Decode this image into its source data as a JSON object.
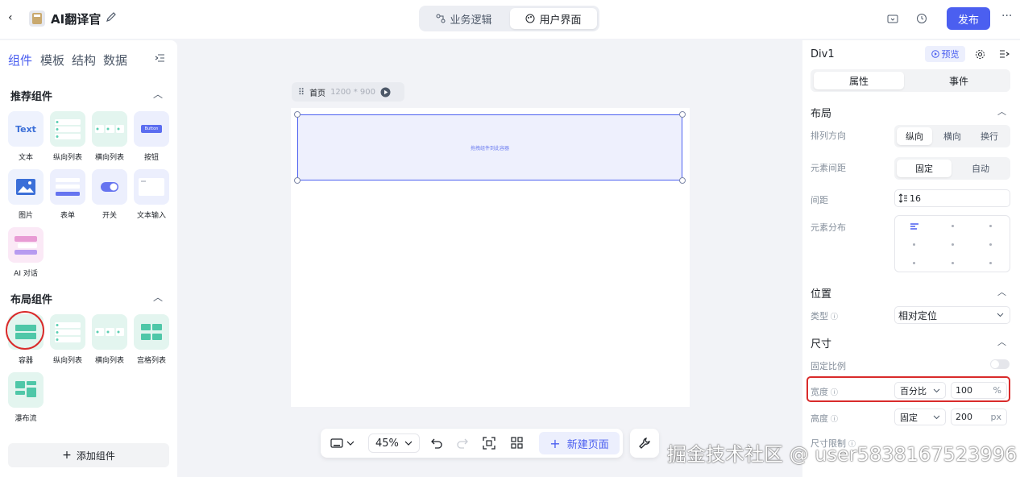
{
  "app": {
    "title": "AI翻译官",
    "back_icon": "chevron-left-icon",
    "edit_icon": "pencil-icon"
  },
  "mode_tabs": [
    {
      "label": "业务逻辑",
      "icon": "flow-icon"
    },
    {
      "label": "用户界面",
      "icon": "palette-icon"
    }
  ],
  "topbar": {
    "publish_label": "发布",
    "accent": "#4b5ff0"
  },
  "left_panel": {
    "tabs": [
      "组件",
      "模板",
      "结构",
      "数据"
    ],
    "recommended": {
      "title": "推荐组件",
      "items": [
        "文本",
        "纵向列表",
        "横向列表",
        "按钮",
        "图片",
        "表单",
        "开关",
        "文本输入",
        "AI 对话"
      ]
    },
    "layout": {
      "title": "布局组件",
      "items": [
        "容器",
        "纵向列表",
        "横向列表",
        "宫格列表",
        "瀑布流"
      ]
    },
    "thumb_text": "Text",
    "thumb_button": "Button",
    "add_label": "添加组件"
  },
  "canvas": {
    "page_name": "首页",
    "size": "1200 * 900",
    "placeholder": "拖拽组件到此容器"
  },
  "bottom_toolbar": {
    "zoom": "45%",
    "new_page_label": "新建页面"
  },
  "right_panel": {
    "element": "Div1",
    "preview_label": "预览",
    "tabs": [
      "属性",
      "事件"
    ],
    "layout_section": "布局",
    "direction_label": "排列方向",
    "direction_options": [
      "纵向",
      "横向",
      "换行"
    ],
    "gap_mode_label": "元素间距",
    "gap_mode_options": [
      "固定",
      "自动"
    ],
    "gap_label": "间距",
    "gap_value": "16",
    "distribution_label": "元素分布",
    "position_section": "位置",
    "type_label": "类型",
    "type_value": "相对定位",
    "size_section": "尺寸",
    "ratio_label": "固定比例",
    "width_label": "宽度",
    "width_mode": "百分比",
    "width_value": "100",
    "width_unit": "%",
    "height_label": "高度",
    "height_mode": "固定",
    "height_value": "200",
    "height_unit": "px",
    "size_limit_label": "尺寸限制"
  },
  "watermark": "掘金技术社区 @ user5838167523996"
}
